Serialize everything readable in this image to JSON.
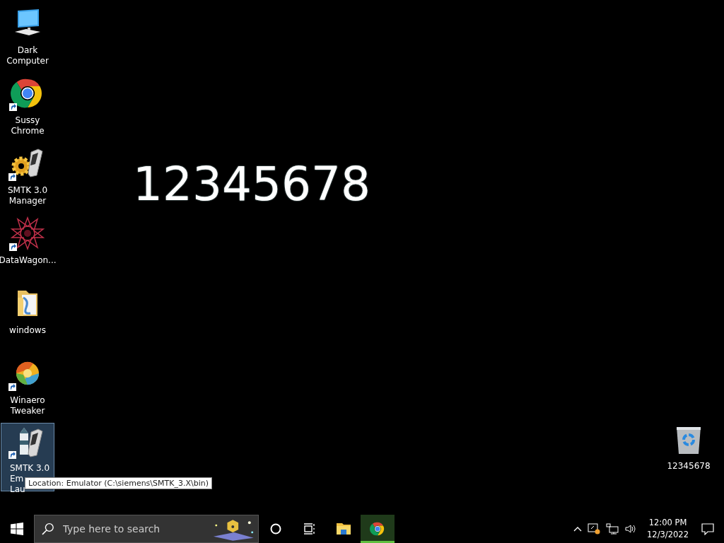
{
  "desktop_icons": [
    {
      "kind": "computer",
      "label_lines": [
        "Dark",
        "Computer"
      ],
      "shortcut": false,
      "selected": false
    },
    {
      "kind": "chrome",
      "label_lines": [
        "Sussy",
        "Chrome"
      ],
      "shortcut": true,
      "selected": false
    },
    {
      "kind": "gear-phone",
      "label_lines": [
        "SMTK 3.0",
        "Manager"
      ],
      "shortcut": true,
      "selected": false
    },
    {
      "kind": "star",
      "label_lines": [
        "DataWagon..."
      ],
      "shortcut": true,
      "selected": false
    },
    {
      "kind": "folder",
      "label_lines": [
        "windows"
      ],
      "shortcut": false,
      "selected": false
    },
    {
      "kind": "swirl",
      "label_lines": [
        "Winaero",
        "Tweaker"
      ],
      "shortcut": true,
      "selected": false
    },
    {
      "kind": "rocket-phone",
      "label_lines": [
        "SMTK 3.0",
        "Em",
        "Lau"
      ],
      "shortcut": true,
      "selected": true
    }
  ],
  "big_text": "12345678",
  "recycle_bin": {
    "label": "12345678"
  },
  "tooltip": "Location: Emulator (C:\\siemens\\SMTK_3.X\\bin)",
  "taskbar": {
    "search": {
      "placeholder": "Type here to search"
    },
    "apps": [
      {
        "kind": "cortana",
        "active": false
      },
      {
        "kind": "task-view",
        "active": false
      },
      {
        "kind": "explorer",
        "active": false
      },
      {
        "kind": "chrome",
        "active": true
      }
    ],
    "clock": {
      "time": "12:00 PM",
      "date": "12/3/2022"
    }
  }
}
